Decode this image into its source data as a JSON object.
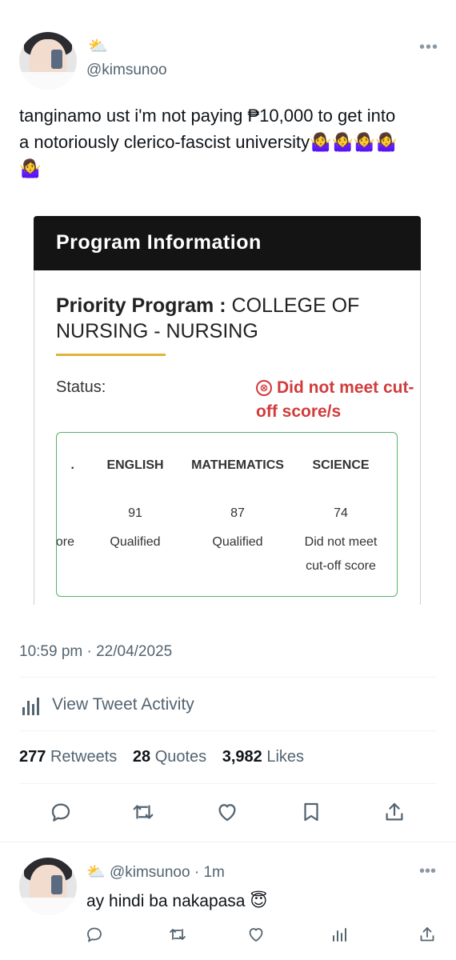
{
  "tweet": {
    "weather_emoji": "⛅",
    "handle": "@kimsunoo",
    "more": "•••",
    "text_line1": "tanginamo ust i'm not paying ₱10,000 to get into",
    "text_line2": "a notoriously clerico-fascist university🤷‍♀️🤷‍♀️🤷‍♀️🤷‍♀️",
    "text_line3": "🤷‍♀️",
    "timestamp": "10:59 pm · 22/04/2025",
    "activity_label": "View Tweet Activity",
    "stats": {
      "retweets_count": "277",
      "retweets_label": "Retweets",
      "quotes_count": "28",
      "quotes_label": "Quotes",
      "likes_count": "3,982",
      "likes_label": "Likes"
    }
  },
  "attachment": {
    "header": "Program Information",
    "program_label": "Priority Program :",
    "program_value": "COLLEGE OF NURSING - NURSING",
    "status_label": "Status:",
    "status_value": "Did not meet cut-off score/s",
    "status_icon": "⊗",
    "cut_header": ".",
    "cut_status": "eet ore",
    "subjects": [
      {
        "name": "ENGLISH",
        "score": "91",
        "status": "Qualified"
      },
      {
        "name": "MATHEMATICS",
        "score": "87",
        "status": "Qualified"
      },
      {
        "name": "SCIENCE",
        "score": "74",
        "status": "Did not meet cut-off score"
      }
    ]
  },
  "reply": {
    "weather_emoji": "⛅",
    "handle_line": "@kimsunoo · 1m",
    "more": "•••",
    "text": "ay hindi ba nakapasa 😇"
  },
  "colors": {
    "status_red": "#d23b3b",
    "underline_gold": "#e0b43c",
    "border_green": "#58b36a",
    "muted": "#536471"
  }
}
